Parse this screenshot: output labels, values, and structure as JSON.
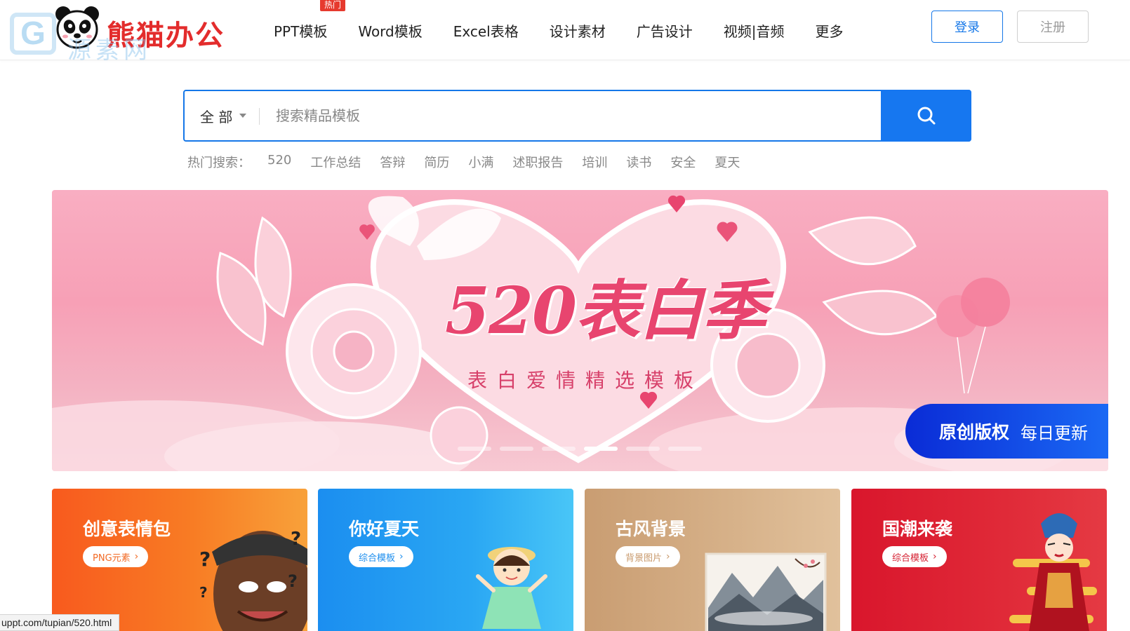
{
  "logo": {
    "brand_text": "熊猫办公",
    "watermark_text": "源素网",
    "g_mark": "G"
  },
  "nav": {
    "items": [
      {
        "label": "PPT模板",
        "badge": "热门"
      },
      {
        "label": "Word模板"
      },
      {
        "label": "Excel表格"
      },
      {
        "label": "设计素材"
      },
      {
        "label": "广告设计"
      },
      {
        "label": "视频|音频"
      },
      {
        "label": "更多"
      }
    ]
  },
  "auth": {
    "login_label": "登录",
    "register_label": "注册"
  },
  "search": {
    "scope_label": "全 部",
    "placeholder": "搜索精品模板",
    "hot_label": "热门搜索：",
    "hot_tags": [
      "520",
      "工作总结",
      "答辩",
      "简历",
      "小满",
      "述职报告",
      "培训",
      "读书",
      "安全",
      "夏天"
    ]
  },
  "banner": {
    "title": "520表白季",
    "subtitle": "表白爱情精选模板",
    "badge_bold": "原创版权",
    "badge_light": "每日更新",
    "slide_count": 6,
    "active_slide": 4
  },
  "cards": [
    {
      "title": "创意表情包",
      "pill": "PNG元素"
    },
    {
      "title": "你好夏天",
      "pill": "综合模板"
    },
    {
      "title": "古风背景",
      "pill": "背景图片"
    },
    {
      "title": "国潮来袭",
      "pill": "综合模板"
    }
  ],
  "statusbar": {
    "url": "uppt.com/tupian/520.html"
  },
  "colors": {
    "accent_blue": "#1677f0",
    "brand_red": "#e32c2c",
    "hot_badge": "#e63a2e"
  },
  "icons": {
    "search": "search-icon",
    "caret": "caret-down-icon",
    "chevron": "chevron-right-icon"
  }
}
